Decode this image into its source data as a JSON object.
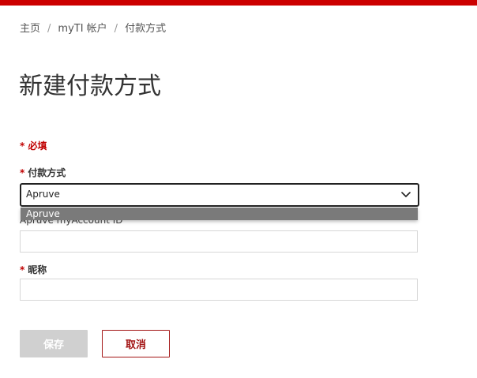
{
  "breadcrumb": {
    "items": [
      "主页",
      "myTI 帐户",
      "付款方式"
    ],
    "separator": "/"
  },
  "page": {
    "title": "新建付款方式"
  },
  "form": {
    "required_note": "* 必填",
    "required_marker": "*",
    "payment_method": {
      "label": "付款方式",
      "selected": "Apruve",
      "options": [
        "Apruve"
      ]
    },
    "account_id": {
      "label": "Apruve myAccount ID",
      "value": ""
    },
    "nickname": {
      "label": "昵称",
      "value": ""
    }
  },
  "actions": {
    "save_label": "保存",
    "cancel_label": "取消"
  },
  "colors": {
    "brand_red": "#cc0000",
    "required_red": "#c00000",
    "cancel_border": "#a31515",
    "disabled_button": "#d0d0d0"
  }
}
